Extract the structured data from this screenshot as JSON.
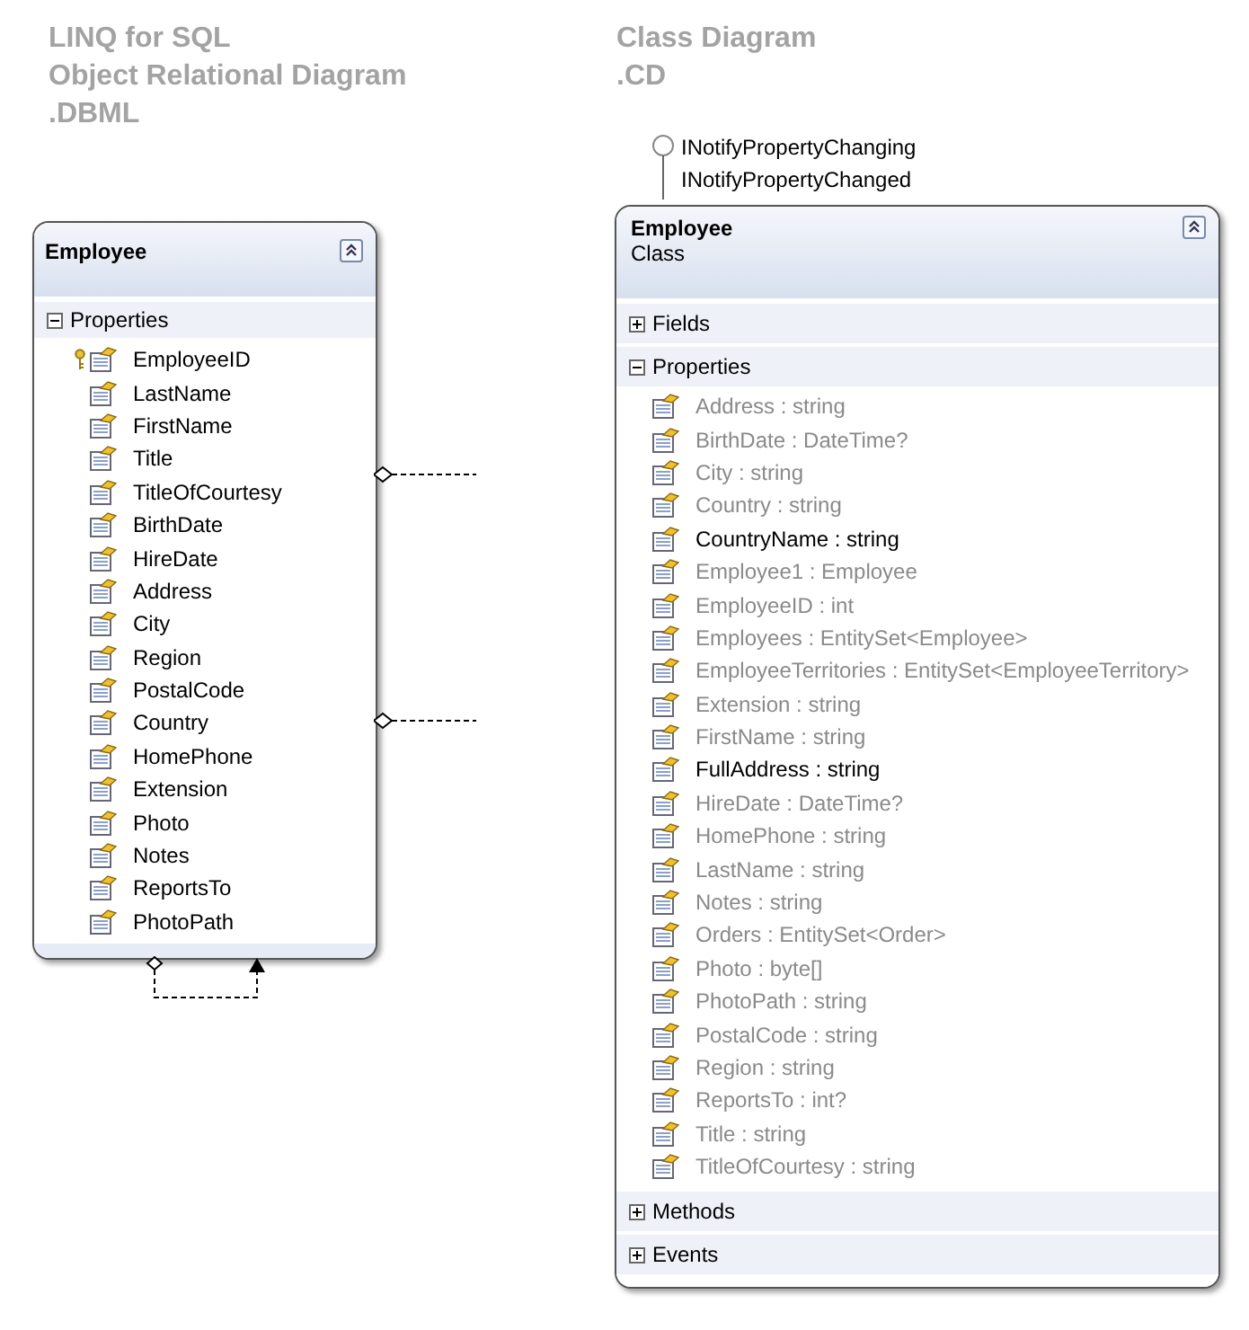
{
  "left": {
    "heading": [
      "LINQ for SQL",
      "Object Relational Diagram",
      ".DBML"
    ],
    "entity": {
      "name": "Employee",
      "sections": [
        {
          "label": "Properties",
          "expanded": true,
          "members": [
            {
              "name": "EmployeeID",
              "key": true
            },
            {
              "name": "LastName",
              "key": false
            },
            {
              "name": "FirstName",
              "key": false
            },
            {
              "name": "Title",
              "key": false
            },
            {
              "name": "TitleOfCourtesy",
              "key": false
            },
            {
              "name": "BirthDate",
              "key": false
            },
            {
              "name": "HireDate",
              "key": false
            },
            {
              "name": "Address",
              "key": false
            },
            {
              "name": "City",
              "key": false
            },
            {
              "name": "Region",
              "key": false
            },
            {
              "name": "PostalCode",
              "key": false
            },
            {
              "name": "Country",
              "key": false
            },
            {
              "name": "HomePhone",
              "key": false
            },
            {
              "name": "Extension",
              "key": false
            },
            {
              "name": "Photo",
              "key": false
            },
            {
              "name": "Notes",
              "key": false
            },
            {
              "name": "ReportsTo",
              "key": false
            },
            {
              "name": "PhotoPath",
              "key": false
            }
          ]
        }
      ]
    }
  },
  "right": {
    "heading": [
      "Class Diagram",
      ".CD"
    ],
    "interfaces": [
      "INotifyPropertyChanging",
      "INotifyPropertyChanged"
    ],
    "class": {
      "name": "Employee",
      "kind": "Class",
      "sections": [
        {
          "label": "Fields",
          "expanded": false
        },
        {
          "label": "Properties",
          "expanded": true,
          "members": [
            {
              "text": "Address : string",
              "greyed": true
            },
            {
              "text": "BirthDate : DateTime?",
              "greyed": true
            },
            {
              "text": "City : string",
              "greyed": true
            },
            {
              "text": "Country : string",
              "greyed": true
            },
            {
              "text": "CountryName : string",
              "greyed": false
            },
            {
              "text": "Employee1 : Employee",
              "greyed": true
            },
            {
              "text": "EmployeeID : int",
              "greyed": true
            },
            {
              "text": "Employees : EntitySet<Employee>",
              "greyed": true
            },
            {
              "text": "EmployeeTerritories : EntitySet<EmployeeTerritory>",
              "greyed": true
            },
            {
              "text": "Extension : string",
              "greyed": true
            },
            {
              "text": "FirstName : string",
              "greyed": true
            },
            {
              "text": "FullAddress : string",
              "greyed": false
            },
            {
              "text": "HireDate : DateTime?",
              "greyed": true
            },
            {
              "text": "HomePhone : string",
              "greyed": true
            },
            {
              "text": "LastName : string",
              "greyed": true
            },
            {
              "text": "Notes : string",
              "greyed": true
            },
            {
              "text": "Orders : EntitySet<Order>",
              "greyed": true
            },
            {
              "text": "Photo : byte[]",
              "greyed": true
            },
            {
              "text": "PhotoPath : string",
              "greyed": true
            },
            {
              "text": "PostalCode : string",
              "greyed": true
            },
            {
              "text": "Region : string",
              "greyed": true
            },
            {
              "text": "ReportsTo : int?",
              "greyed": true
            },
            {
              "text": "Title : string",
              "greyed": true
            },
            {
              "text": "TitleOfCourtesy : string",
              "greyed": true
            }
          ]
        },
        {
          "label": "Methods",
          "expanded": false
        },
        {
          "label": "Events",
          "expanded": false
        }
      ]
    }
  }
}
